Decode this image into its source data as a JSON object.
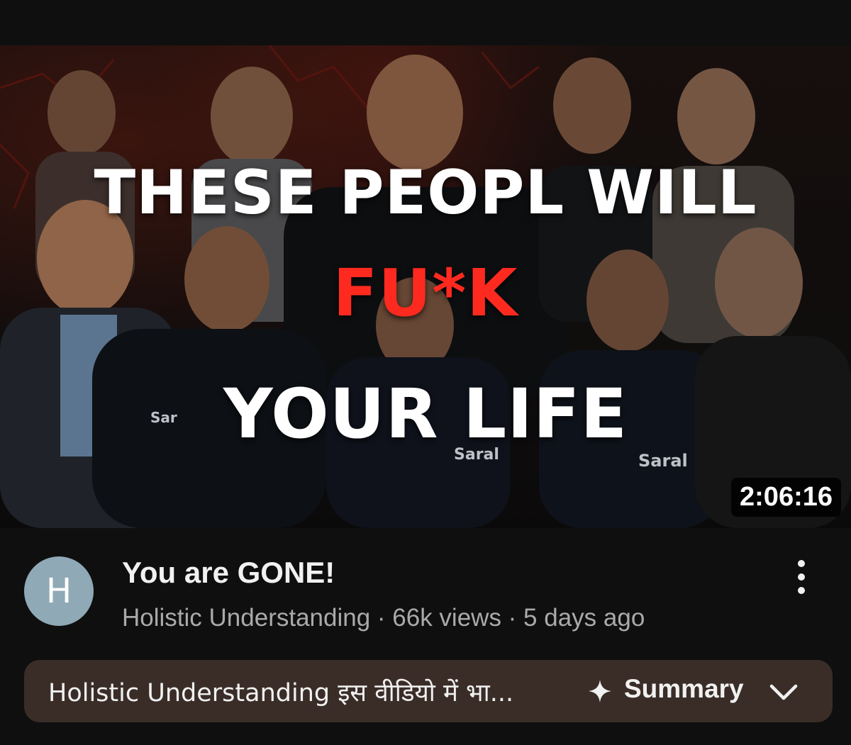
{
  "video": {
    "thumbnail": {
      "line1": "THESE PEOPL WILL",
      "line2": "FU*K",
      "line3": "YOUR LIFE",
      "shirt_logo_left": "Saral",
      "shirt_logo_right": "Saral",
      "shirt_partial": "Sar",
      "duration": "2:06:16"
    },
    "title": "You are GONE!",
    "channel_initial": "H",
    "meta": "Holistic Understanding · 66k views · 5 days ago"
  },
  "summary": {
    "text": "Holistic Understanding इस वीडियो में भा...",
    "label": "Summary",
    "sparkle_icon": "sparkle-icon",
    "chevron_icon": "chevron-down-icon"
  },
  "menu_icon": "more-vert-icon"
}
